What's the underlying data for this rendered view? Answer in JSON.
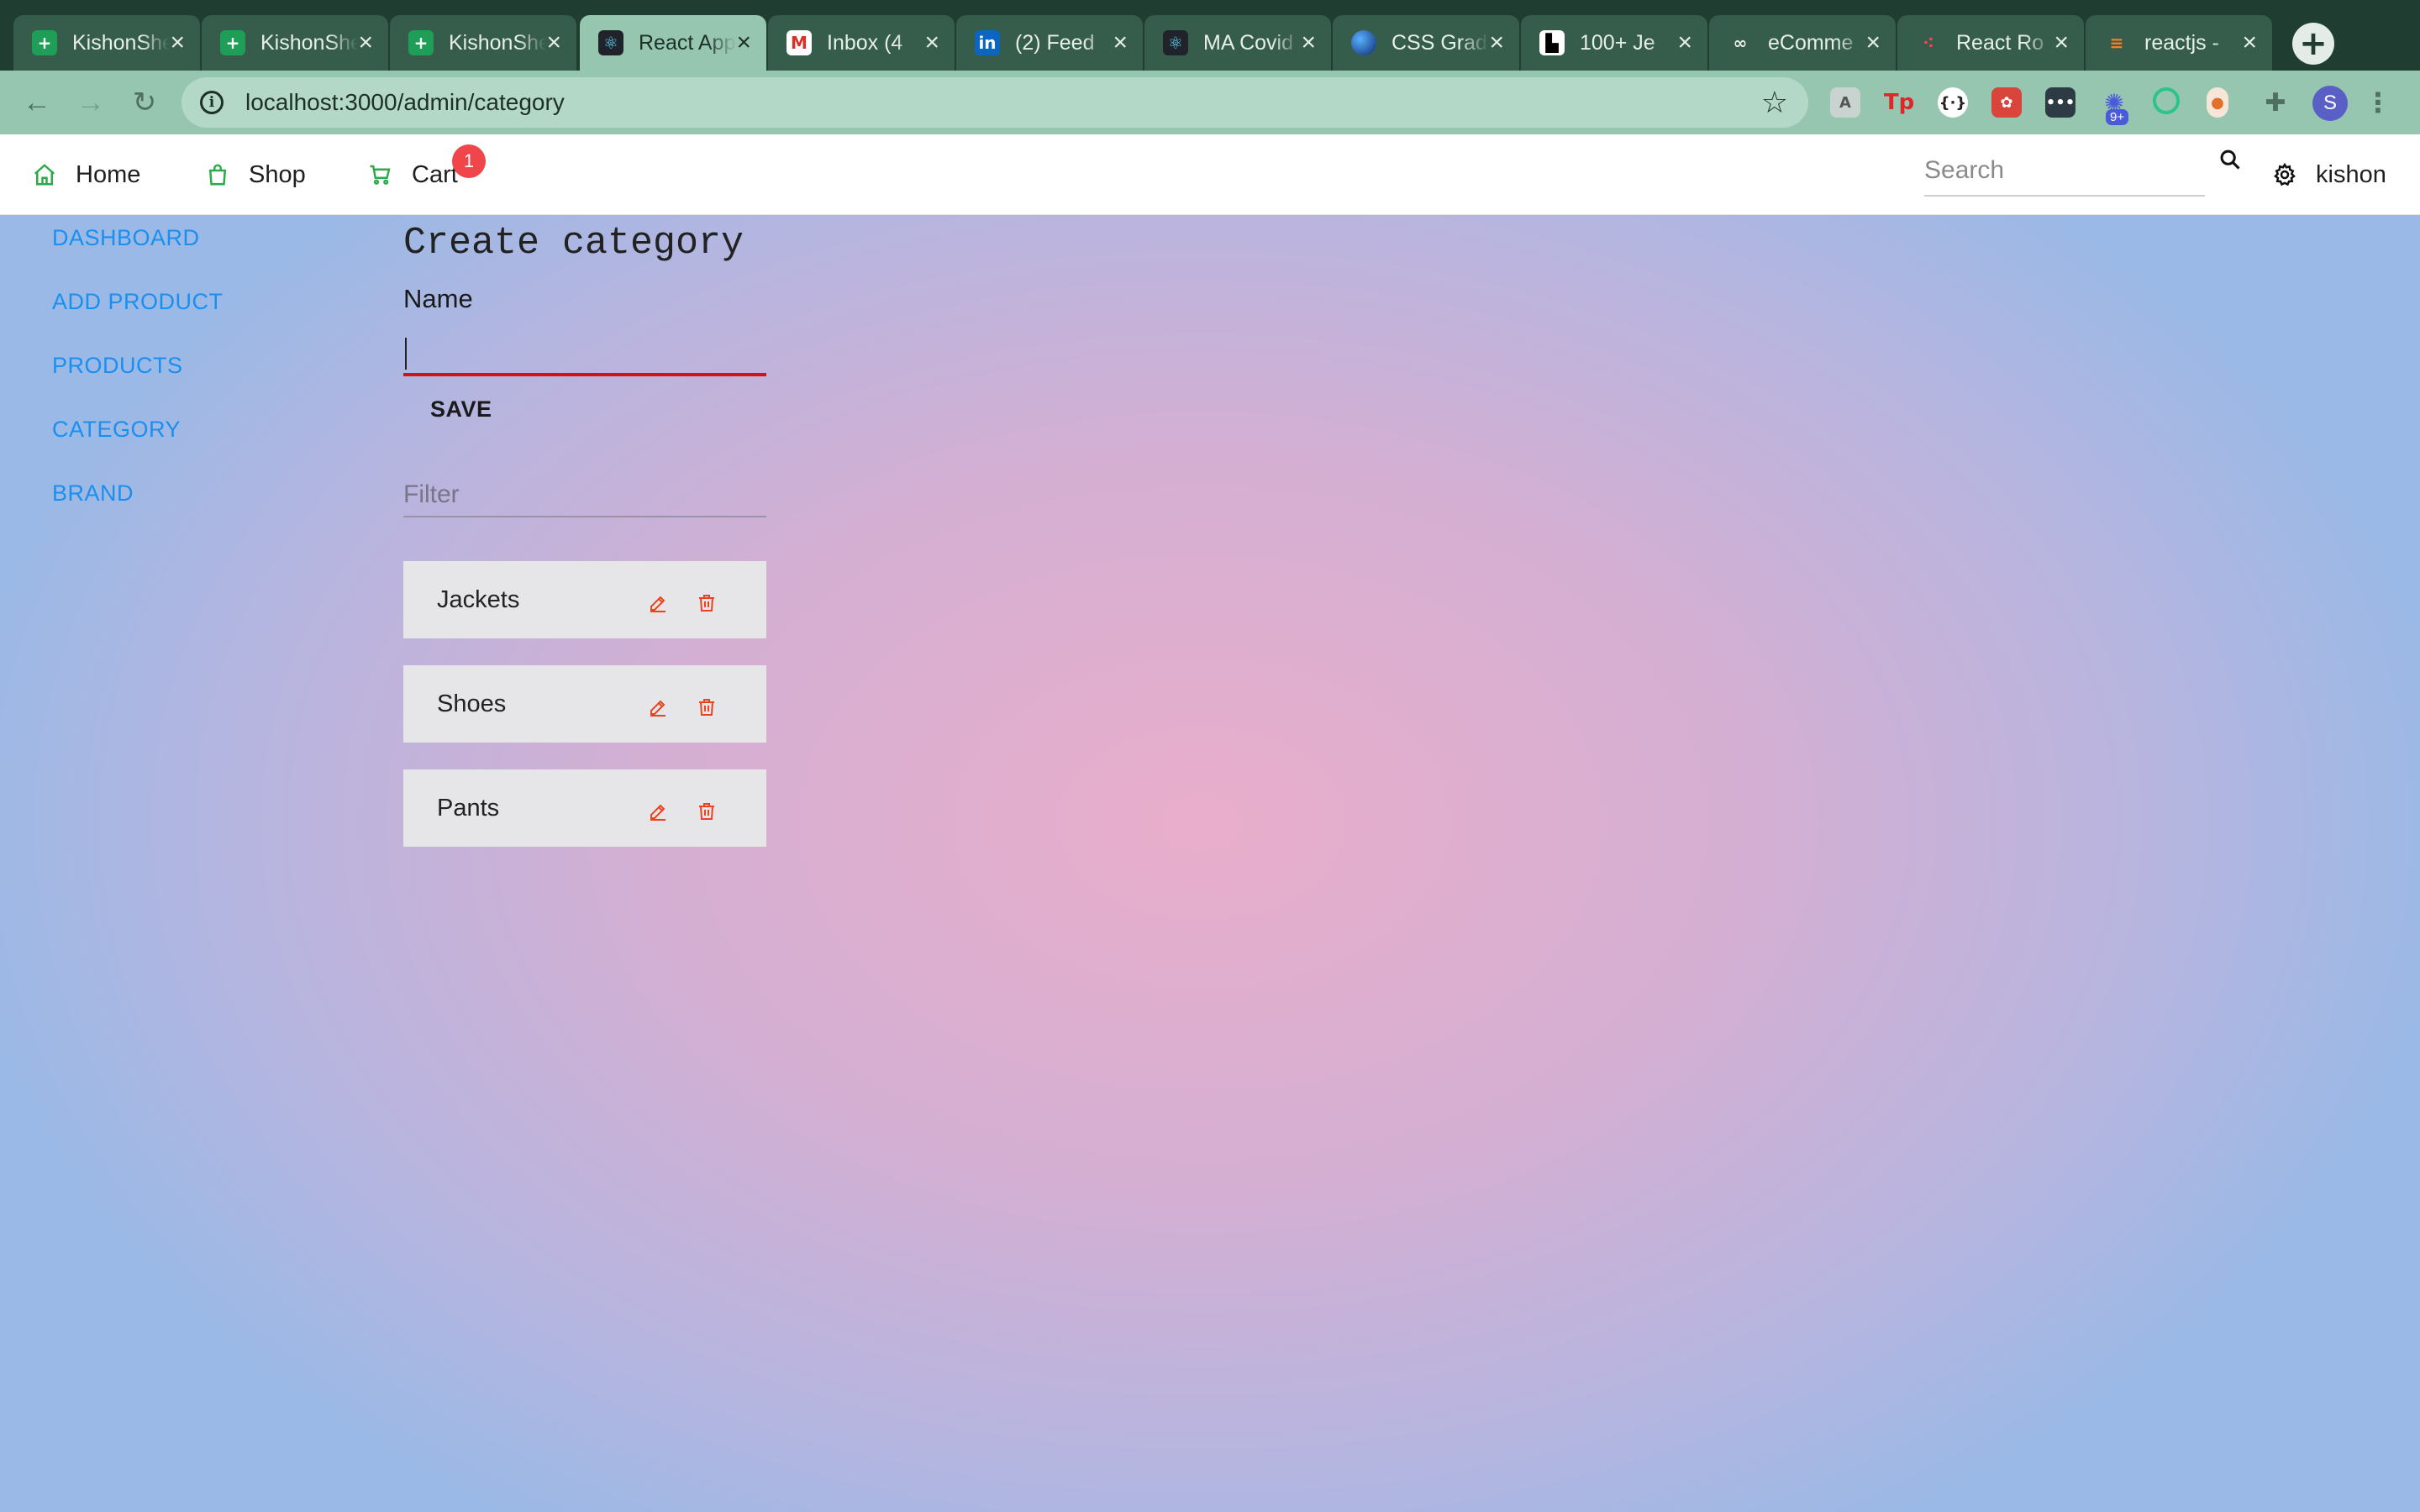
{
  "browser": {
    "tabs": [
      {
        "title": "KishonSheet",
        "icon": "google-sheets-icon",
        "active": false
      },
      {
        "title": "KishonSheet",
        "icon": "google-sheets-icon",
        "active": false
      },
      {
        "title": "KishonSheet",
        "icon": "google-sheets-icon",
        "active": false
      },
      {
        "title": "React App",
        "icon": "react-icon",
        "active": true
      },
      {
        "title": "Inbox (4",
        "icon": "gmail-icon",
        "active": false
      },
      {
        "title": "(2) Feed",
        "icon": "linkedin-icon",
        "active": false
      },
      {
        "title": "MA Covid",
        "icon": "react-icon",
        "active": false
      },
      {
        "title": "CSS Grad",
        "icon": "globe-icon",
        "active": false
      },
      {
        "title": "100+ Je",
        "icon": "unsplash-icon",
        "active": false
      },
      {
        "title": "eComme",
        "icon": "squarespace-icon",
        "active": false
      },
      {
        "title": "React Ro",
        "icon": "react-router-icon",
        "active": false
      },
      {
        "title": "reactjs -",
        "icon": "stackoverflow-icon",
        "active": false
      }
    ],
    "url": "localhost:3000/admin/category",
    "profile_initial": "S",
    "extension_badge": "9+"
  },
  "nav": {
    "home": "Home",
    "shop": "Shop",
    "cart": "Cart",
    "cart_count": "1",
    "search_placeholder": "Search",
    "user": "kishon"
  },
  "sidebar": {
    "items": [
      "DASHBOARD",
      "ADD PRODUCT",
      "PRODUCTS",
      "CATEGORY",
      "BRAND"
    ]
  },
  "form": {
    "title": "Create category",
    "name_label": "Name",
    "name_value": "",
    "save_label": "SAVE",
    "filter_placeholder": "Filter"
  },
  "categories": [
    "Jackets",
    "Shoes",
    "Pants"
  ],
  "colors": {
    "accent_link": "#1a8ff0",
    "nav_icon": "#2eaa4a",
    "action_icon": "#e8451f",
    "badge": "#f0454a",
    "input_focus": "#d11313"
  }
}
